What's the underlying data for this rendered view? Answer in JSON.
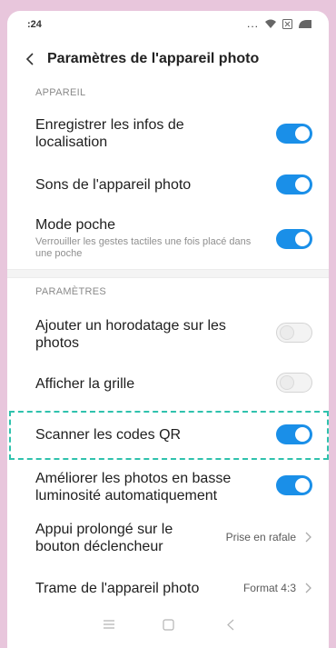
{
  "status_bar": {
    "time": ":24",
    "dots": "..."
  },
  "header": {
    "title": "Paramètres de l'appareil photo"
  },
  "sections": {
    "appareil": "APPAREIL",
    "parametres": "PARAMÈTRES"
  },
  "settings": {
    "localisation": {
      "label": "Enregistrer les infos de localisation",
      "on": true
    },
    "sons": {
      "label": "Sons de l'appareil photo",
      "on": true
    },
    "mode_poche": {
      "label": "Mode poche",
      "desc": "Verrouiller les gestes tactiles une fois placé dans une poche",
      "on": true
    },
    "horodatage": {
      "label": "Ajouter un horodatage sur les photos",
      "on": false
    },
    "grille": {
      "label": "Afficher la grille",
      "on": false
    },
    "qr": {
      "label": "Scanner les codes QR",
      "on": true
    },
    "basse_lum": {
      "label": "Améliorer les photos en basse luminosité automatiquement",
      "on": true
    },
    "appui": {
      "label": "Appui prolongé sur le bouton déclencheur",
      "value": "Prise en rafale"
    },
    "trame": {
      "label": "Trame de l'appareil photo",
      "value": "Format 4:3"
    }
  },
  "colors": {
    "accent": "#1a8fe8",
    "highlight": "#2fc2ad",
    "background": "#e8c6dc"
  },
  "icons": [
    "back-arrow-icon",
    "wifi-icon",
    "sim-icon",
    "battery-icon",
    "chevron-right-icon",
    "menu-nav-icon",
    "home-nav-icon",
    "back-nav-icon"
  ]
}
